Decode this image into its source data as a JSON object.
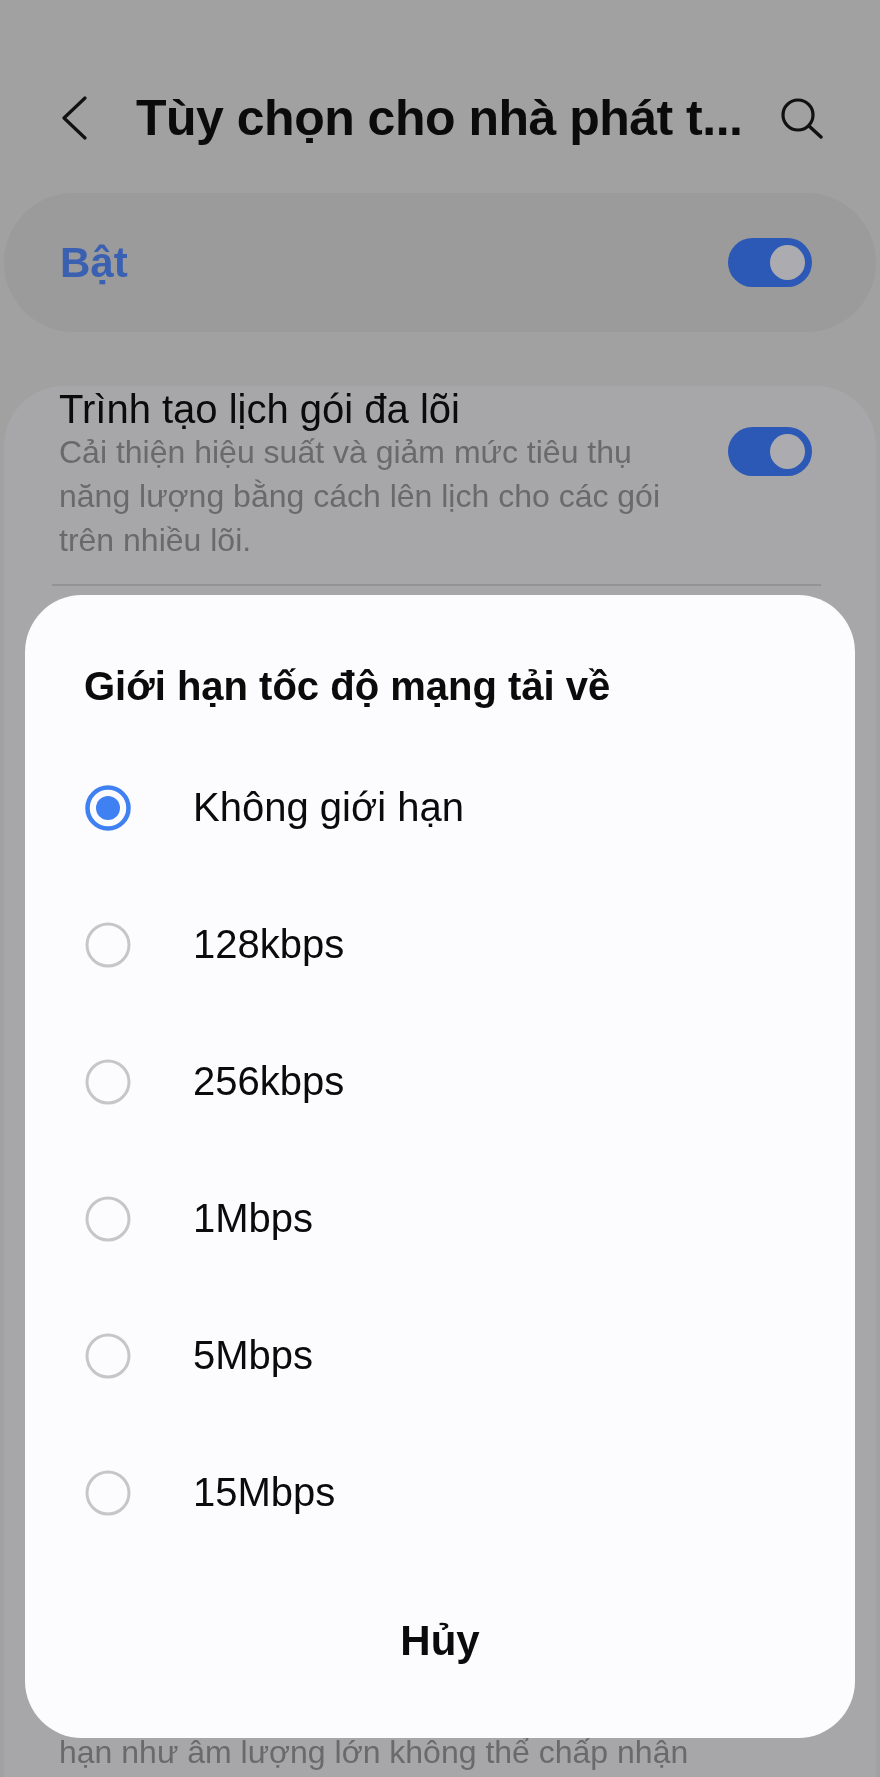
{
  "header": {
    "title": "Tùy chọn cho nhà phát t..."
  },
  "master_switch": {
    "label": "Bật",
    "on": true
  },
  "settings": [
    {
      "kind": "toggle",
      "title": "Trình tạo lịch gói đa lõi",
      "description": "Cải thiện hiệu suất và giảm mức tiêu thụ năng lượng bằng cách lên lịch cho các gói trên nhiều lõi.",
      "on": true
    },
    {
      "kind": "text",
      "description": "hạn như âm lượng lớn không thể chấp nhận"
    }
  ],
  "dialog": {
    "title": "Giới hạn tốc độ mạng tải về",
    "options": [
      {
        "label": "Không giới hạn",
        "selected": true
      },
      {
        "label": "128kbps",
        "selected": false
      },
      {
        "label": "256kbps",
        "selected": false
      },
      {
        "label": "1Mbps",
        "selected": false
      },
      {
        "label": "5Mbps",
        "selected": false
      },
      {
        "label": "15Mbps",
        "selected": false
      }
    ],
    "cancel": "Hủy"
  }
}
